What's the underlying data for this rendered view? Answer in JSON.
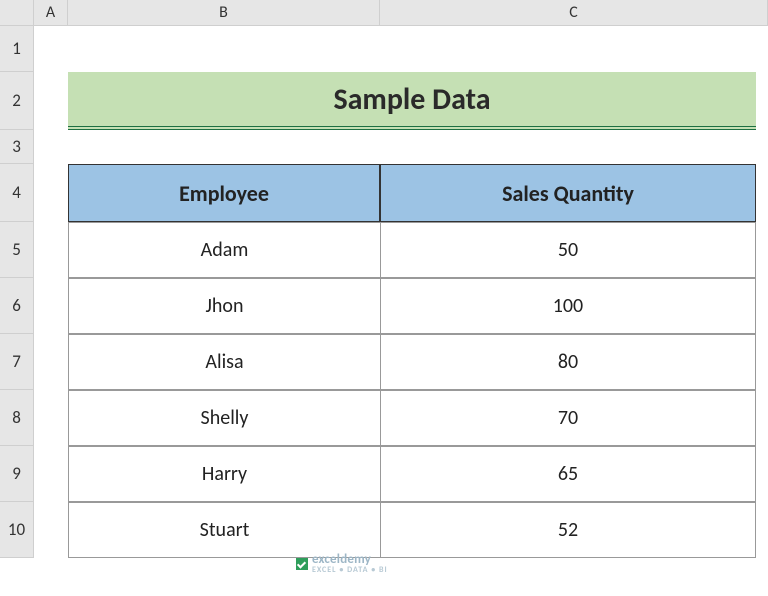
{
  "columns": [
    "A",
    "B",
    "C"
  ],
  "rows": [
    "1",
    "2",
    "3",
    "4",
    "5",
    "6",
    "7",
    "8",
    "9",
    "10"
  ],
  "title": "Sample Data",
  "table": {
    "headers": [
      "Employee",
      "Sales Quantity"
    ],
    "rows": [
      {
        "employee": "Adam",
        "qty": "50"
      },
      {
        "employee": "Jhon",
        "qty": "100"
      },
      {
        "employee": "Alisa",
        "qty": "80"
      },
      {
        "employee": "Shelly",
        "qty": "70"
      },
      {
        "employee": "Harry",
        "qty": "65"
      },
      {
        "employee": "Stuart",
        "qty": "52"
      }
    ]
  },
  "watermark": {
    "brand": "exceldemy",
    "sub": "EXCEL • DATA • BI"
  }
}
